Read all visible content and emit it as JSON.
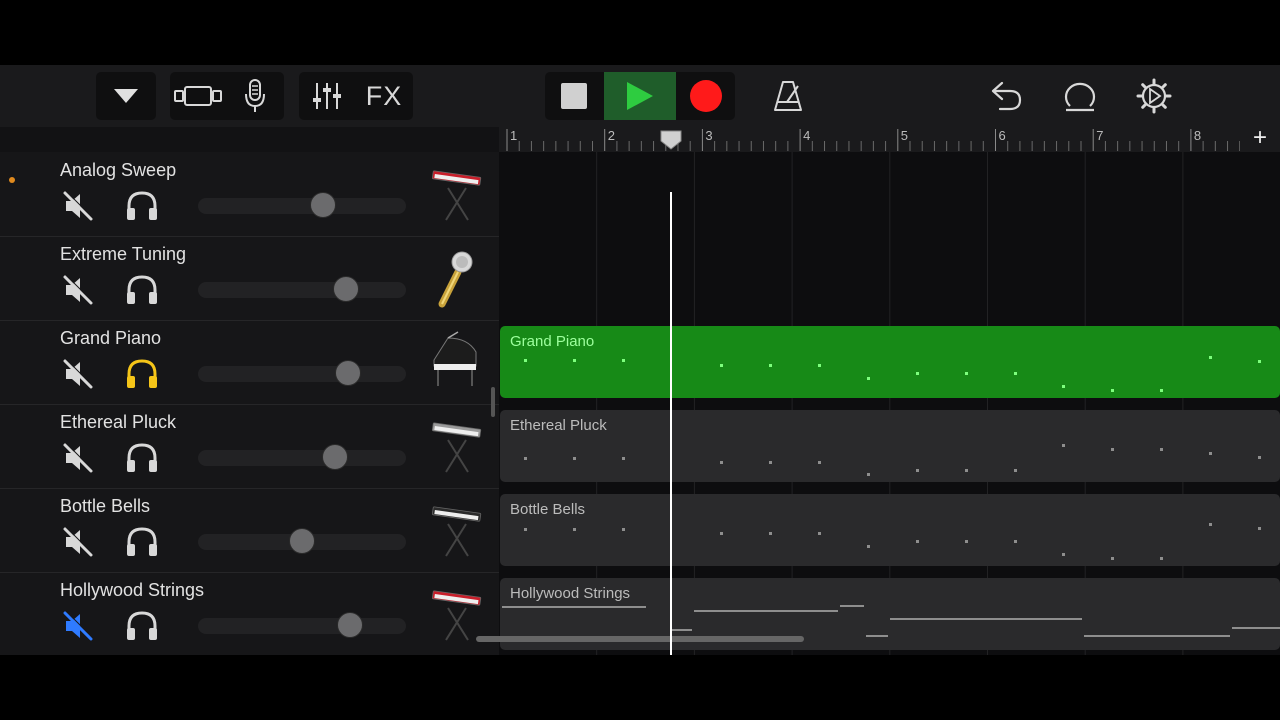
{
  "toolbar": {
    "left_buttons": [
      {
        "icon": "browser-arrow-icon"
      },
      {
        "icon": "tracks-view-icon"
      },
      {
        "icon": "microphone-icon"
      },
      {
        "icon": "mixer-icon"
      },
      {
        "label": "FX"
      }
    ],
    "transport": {
      "stop_icon": "stop-icon",
      "play_icon": "play-icon",
      "record_icon": "record-icon"
    },
    "right_buttons": [
      "metronome-icon",
      "undo-icon",
      "loop-icon",
      "settings-icon"
    ],
    "colors": {
      "play": "#2ecc40",
      "play_bg": "#1f5d2a",
      "record": "#ff1a1a"
    }
  },
  "ruler": {
    "bars": [
      "1",
      "2",
      "3",
      "4",
      "5",
      "6",
      "7",
      "8"
    ],
    "add_label": "+",
    "playhead_bar": 2.75
  },
  "tracks": [
    {
      "name": "Analog Sweep",
      "muted": true,
      "solo": false,
      "volume": 0.6,
      "instrument": "keyboard-red-icon",
      "recording_dot": true
    },
    {
      "name": "Extreme Tuning",
      "muted": true,
      "solo": false,
      "volume": 0.71,
      "instrument": "microphone-gold-icon"
    },
    {
      "name": "Grand Piano",
      "muted": true,
      "solo": true,
      "volume": 0.72,
      "instrument": "grand-piano-icon"
    },
    {
      "name": "Ethereal Pluck",
      "muted": true,
      "solo": false,
      "volume": 0.66,
      "instrument": "keyboard-silver-icon"
    },
    {
      "name": "Bottle Bells",
      "muted": true,
      "solo": false,
      "volume": 0.5,
      "instrument": "keyboard-black-icon"
    },
    {
      "name": "Hollywood Strings",
      "muted": true,
      "mute_active": true,
      "solo": false,
      "volume": 0.73,
      "instrument": "keyboard-red-icon"
    }
  ],
  "regions": [
    {
      "track": "Grand Piano",
      "label": "Grand Piano",
      "selected": true,
      "color": "#178a17",
      "text_color": "#9dff9d",
      "note_color": "#7dff7d"
    },
    {
      "track": "Ethereal Pluck",
      "label": "Ethereal Pluck",
      "selected": false,
      "color": "#2a2a2c",
      "text_color": "#bcbcbc",
      "note_color": "#8e8e8e"
    },
    {
      "track": "Bottle Bells",
      "label": "Bottle Bells",
      "selected": false,
      "color": "#2a2a2c",
      "text_color": "#bcbcbc",
      "note_color": "#8e8e8e"
    },
    {
      "track": "Hollywood Strings",
      "label": "Hollywood Strings",
      "selected": false,
      "color": "#2a2a2c",
      "text_color": "#bcbcbc",
      "note_color": "#8e8e8e"
    }
  ],
  "colors": {
    "solo_active": "#f5c518",
    "mute_active": "#2f7bff"
  }
}
